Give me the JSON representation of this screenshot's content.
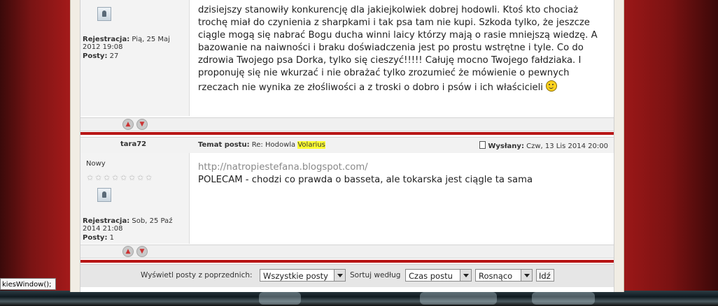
{
  "post1": {
    "registration_label": "Rejestracja:",
    "registration_line1": "Pią, 25 Maj",
    "registration_line2": "2012 19:08",
    "posts_label": "Posty:",
    "posts_count": "27",
    "text_lines": [
      "dzisiejszy stanowiły konkurencję dla jakiejkolwiek dobrej hodowli. Ktoś kto chociaż",
      "trochę miał do czynienia z sharpkami i tak psa tam nie kupi. Szkoda tylko, że jeszcze",
      "ciągle mogą się nabrać Bogu ducha winni laicy którzy mają o rasie mniejszą wiedzę. A",
      "bazowanie na naiwności i braku doświadczenia jest po prostu wstrętne i tyle. Co do",
      "zdrowia Twojego psa Dorka, tylko się cieszyć!!!!! Całuję mocno Twojego fałdziaka. I",
      "proponuję się nie wkurzać i nie obrażać tylko zrozumieć że mówienie o pewnych",
      "rzeczach nie wynika ze złośliwości a z troski o dobro i psów i ich właścicieli"
    ]
  },
  "post2": {
    "author": "tara72",
    "subject_label": "Temat postu:",
    "subject_prefix": "Re: Hodowla",
    "subject_highlight": "Volarius",
    "sent_label": "Wysłany:",
    "sent_value": "Czw, 13 Lis 2014 20:00",
    "rank": "Nowy",
    "registration_label": "Rejestracja:",
    "registration_line1": "Sob, 25 Paź",
    "registration_line2": "2014 21:08",
    "posts_label": "Posty:",
    "posts_count": "1",
    "link": "http://natropiestefana.blogspot.com/",
    "text": "POLECAM - chodzi co prawda o basseta, ale tokarska jest ciągle ta sama"
  },
  "controls": {
    "show_label": "Wyświetl posty z poprzednich:",
    "show_value": "Wszystkie posty",
    "sort_label": "Sortuj według",
    "sort_value": "Czas postu",
    "order_value": "Rosnąco",
    "go_label": "Idź"
  },
  "status_tooltip": "kiesWindow();",
  "colors": {
    "divider": "#b71515",
    "highlight": "#ffff33",
    "background_red": "#a41a1a"
  }
}
